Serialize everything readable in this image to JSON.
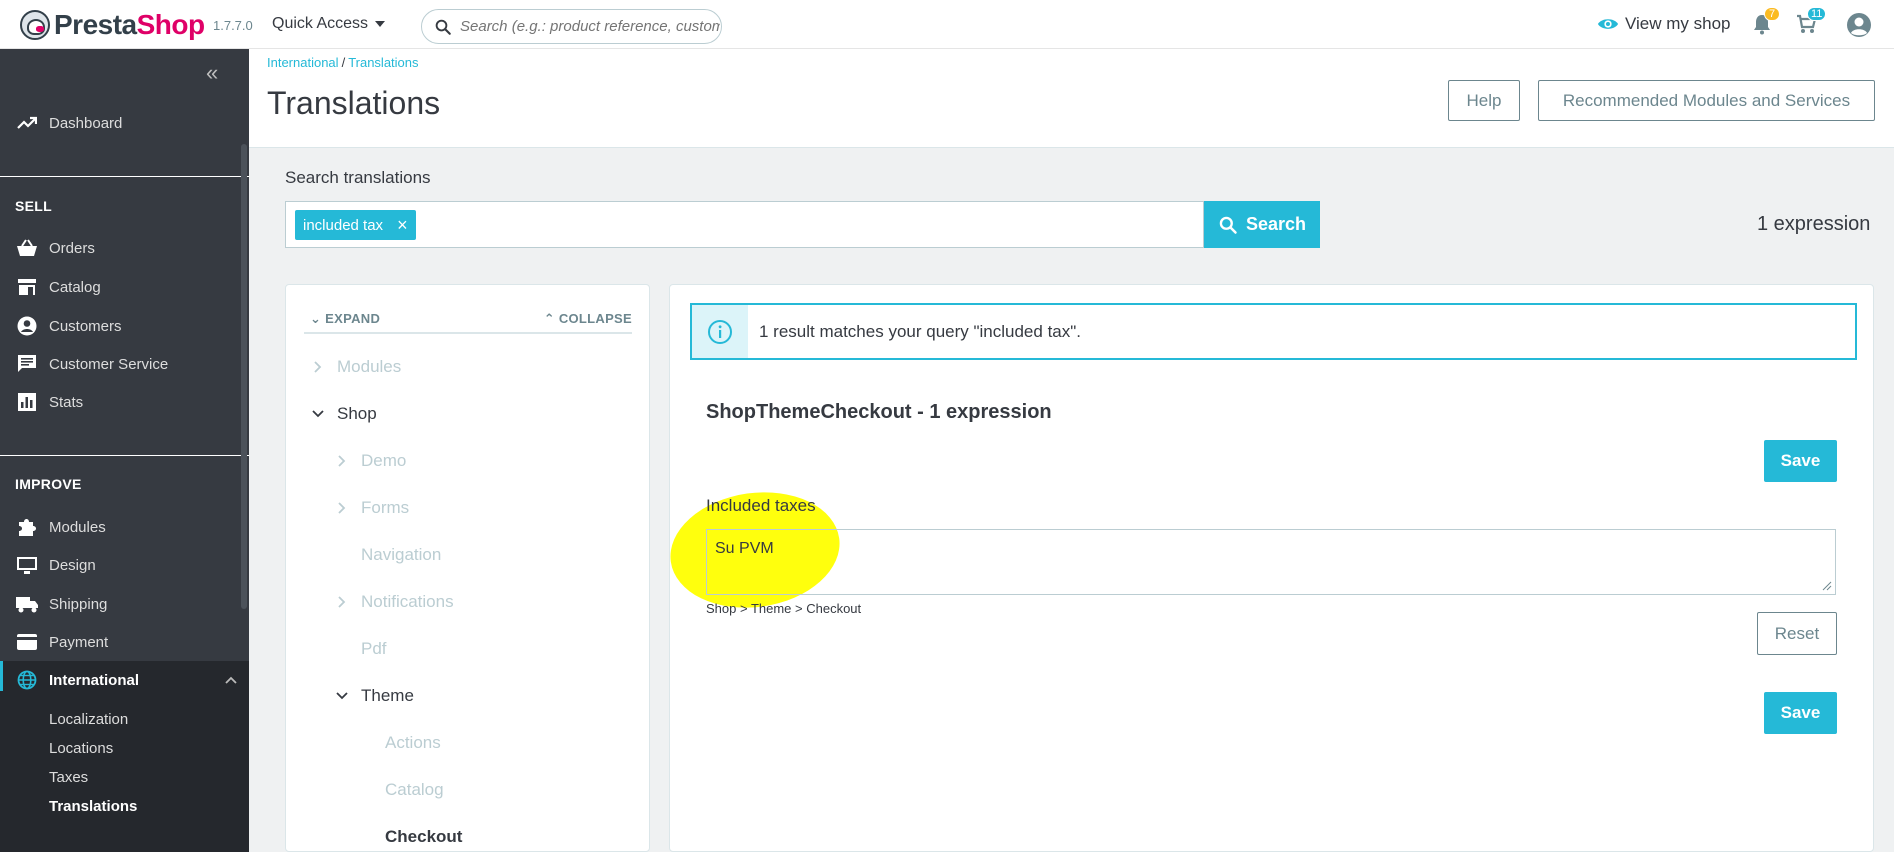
{
  "header": {
    "logo_part1": "Presta",
    "logo_part2": "Shop",
    "version": "1.7.7.0",
    "quick_access": "Quick Access",
    "search_placeholder": "Search (e.g.: product reference, custome",
    "view_shop": "View my shop",
    "notifications_count": "7",
    "orders_count": "11"
  },
  "sidebar": {
    "dashboard": "Dashboard",
    "sell_section": "SELL",
    "sell_items": [
      "Orders",
      "Catalog",
      "Customers",
      "Customer Service",
      "Stats"
    ],
    "improve_section": "IMPROVE",
    "improve_items": [
      "Modules",
      "Design",
      "Shipping",
      "Payment",
      "International"
    ],
    "international_sub": [
      "Localization",
      "Locations",
      "Taxes",
      "Translations"
    ]
  },
  "page": {
    "breadcrumb_parent": "International",
    "breadcrumb_sep": "/",
    "breadcrumb_current": "Translations",
    "title": "Translations",
    "help_btn": "Help",
    "recommended_btn": "Recommended Modules and Services"
  },
  "search": {
    "label": "Search translations",
    "tag": "included tax",
    "tag_remove": "×",
    "button": "Search",
    "expression_count": "1 expression"
  },
  "tree": {
    "expand": "EXPAND",
    "collapse": "COLLAPSE",
    "items": [
      "Modules",
      "Shop",
      "Demo",
      "Forms",
      "Navigation",
      "Notifications",
      "Pdf",
      "Theme",
      "Actions",
      "Catalog",
      "Checkout"
    ]
  },
  "results": {
    "alert": "1 result matches your query \"included tax\".",
    "group_title": "ShopThemeCheckout - 1 expression",
    "save": "Save",
    "field_label": "Included taxes",
    "field_value": "Su PVM",
    "path": "Shop > Theme > Checkout",
    "reset": "Reset"
  },
  "colors": {
    "accent": "#25b9d7",
    "brand_pink": "#df0067",
    "sidebar_bg": "#363a41",
    "highlight": "#ffff00",
    "notif_badge": "#fbbb22"
  }
}
